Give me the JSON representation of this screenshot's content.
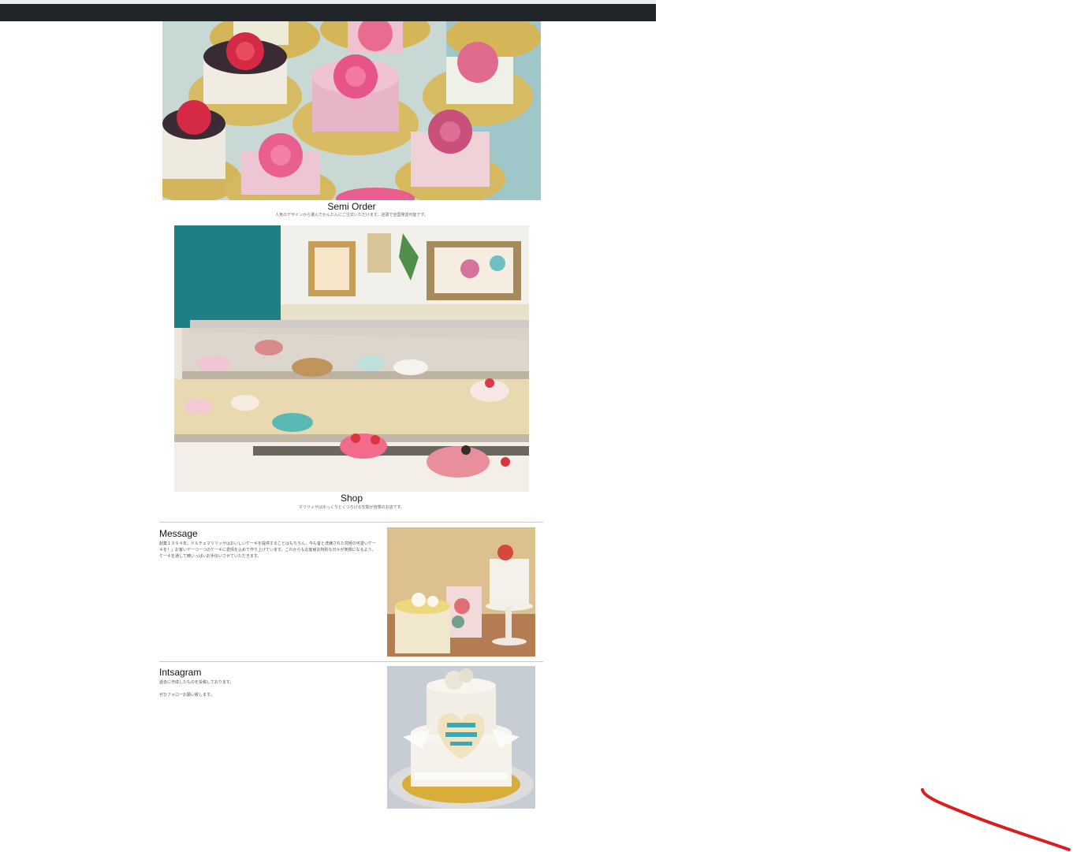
{
  "semi_order": {
    "title": "Semi Order",
    "subtitle": "人気のデザインから選んでかんたんにご注文いただけます。店頭で全国発送可能です。"
  },
  "shop": {
    "title": "Shop",
    "subtitle": "マリリッサはゆっくりとくつろげる空間が自慢のお店です。"
  },
  "message": {
    "title": "Message",
    "text": "創業１９９４年。ドルチェマリリッサはおいしいケーキを提供することはもちろん、今も昔と洗練された究極の可愛いケーキを！」お客いデーつーつのケーキに愛情を込めて作り上げています。これからもお客様お特別な日々が笑顔になるよう、ケーキを通して精いっぱいお手伝いさせていただきます。"
  },
  "instagram": {
    "title": "Intsagram",
    "text_1": "過去に作成したものを投稿しております。",
    "text_2": "ぜひフォローお願い致します。"
  },
  "colors": {
    "navbar": "#212529",
    "annotation": "#d81e1e"
  }
}
